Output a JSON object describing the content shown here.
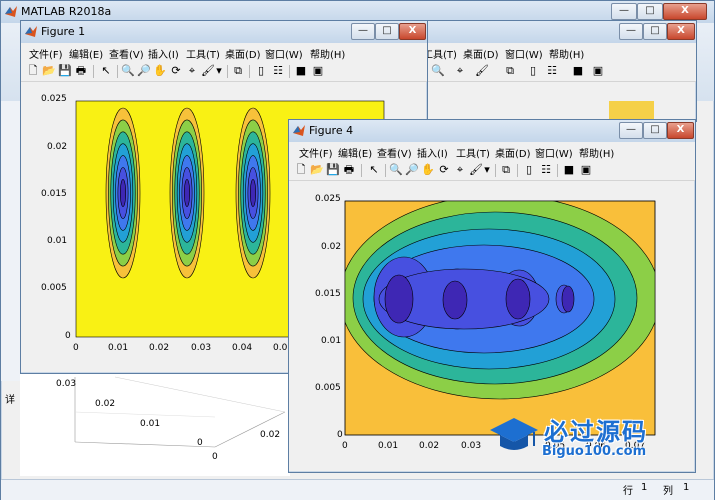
{
  "app": {
    "title": "MATLAB R2018a"
  },
  "figure1": {
    "title": "Figure 1"
  },
  "figure4": {
    "title": "Figure 4"
  },
  "menus": [
    "文件(F)",
    "编辑(E)",
    "查看(V)",
    "插入(I)",
    "工具(T)",
    "桌面(D)",
    "窗口(W)",
    "帮助(H)"
  ],
  "window_controls": {
    "minimize": "—",
    "maximize": "□",
    "close": "X"
  },
  "plot1": {
    "yticks": [
      "0.025",
      "0.02",
      "0.015",
      "0.01",
      "0.005",
      "0"
    ],
    "xticks": [
      "0",
      "0.01",
      "0.02",
      "0.03",
      "0.04",
      "0.05"
    ]
  },
  "plot4": {
    "yticks": [
      "0.025",
      "0.02",
      "0.015",
      "0.01",
      "0.005",
      "0"
    ],
    "xticks": [
      "0",
      "0.01",
      "0.02",
      "0.03",
      "0.04",
      "0.05",
      "0.06",
      "0.07"
    ]
  },
  "background_plot": {
    "yticks": [
      "0.03",
      "0.02",
      "0.01",
      "0"
    ],
    "xticks": [
      "0",
      "0.02"
    ],
    "left_label": "详"
  },
  "statusbar": {
    "row_label": "行",
    "row_value": "1",
    "col_label": "列",
    "col_value": "1"
  },
  "watermark": {
    "text_cn": "必过源码",
    "text_url": "Biguo100.com"
  },
  "colors": {
    "titlebar": "#c4d6ea",
    "contour_yellow": "#f9f114",
    "contour_blue_dark": "#3e27b4"
  }
}
